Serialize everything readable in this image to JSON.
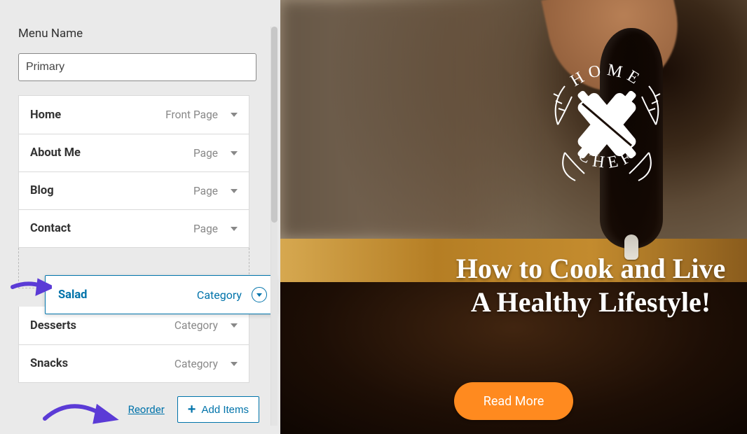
{
  "sidebar": {
    "menu_name_label": "Menu Name",
    "menu_name_value": "Primary",
    "items_top": [
      {
        "label": "Home",
        "type": "Front Page"
      },
      {
        "label": "About Me",
        "type": "Page"
      },
      {
        "label": "Blog",
        "type": "Page"
      },
      {
        "label": "Contact",
        "type": "Page"
      }
    ],
    "dragged_item": {
      "label": "Salad",
      "type": "Category"
    },
    "items_bottom": [
      {
        "label": "Desserts",
        "type": "Category"
      },
      {
        "label": "Snacks",
        "type": "Category"
      }
    ],
    "reorder_label": "Reorder",
    "add_items_label": "Add Items"
  },
  "preview": {
    "logo_top": "HOME",
    "logo_bottom": "CHEF",
    "headline_line1": "How to Cook and Live",
    "headline_line2": "A Healthy Lifestyle!",
    "cta_label": "Read More"
  }
}
